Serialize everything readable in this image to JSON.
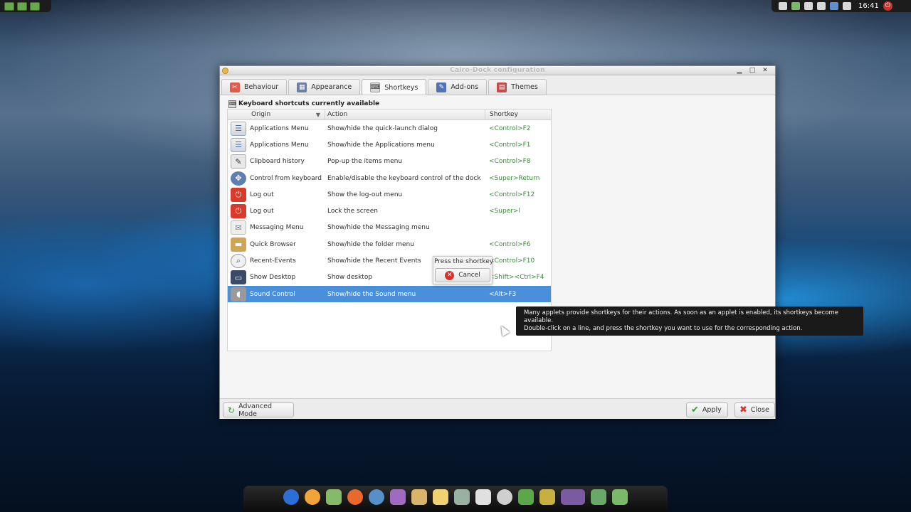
{
  "window": {
    "title": "Cairo-Dock configuration",
    "controls": {
      "minimize": "▁",
      "maximize": "□",
      "close": "✕"
    }
  },
  "tabs": [
    {
      "label": "Behaviour",
      "icon": "behaviour-icon",
      "glyph": "✂"
    },
    {
      "label": "Appearance",
      "icon": "appearance-icon",
      "glyph": "▦"
    },
    {
      "label": "Shortkeys",
      "icon": "shortkeys-icon",
      "glyph": "⌨",
      "active": true
    },
    {
      "label": "Add-ons",
      "icon": "addons-icon",
      "glyph": "✎"
    },
    {
      "label": "Themes",
      "icon": "themes-icon",
      "glyph": "▤"
    }
  ],
  "section": {
    "title": "Keyboard shortcuts currently available"
  },
  "table": {
    "headers": {
      "origin": "Origin",
      "action": "Action",
      "shortkey": "Shortkey"
    },
    "rows": [
      {
        "origin": "Applications Menu",
        "action": "Show/hide the quick-launch dialog",
        "shortkey": "<Control>F2",
        "icon": "applications-menu-icon"
      },
      {
        "origin": "Applications Menu",
        "action": "Show/hide the Applications menu",
        "shortkey": "<Control>F1",
        "icon": "applications-menu-icon"
      },
      {
        "origin": "Clipboard history",
        "action": "Pop-up the items menu",
        "shortkey": "<Control>F8",
        "icon": "clipboard-icon"
      },
      {
        "origin": "Control from keyboard",
        "action": "Enable/disable the keyboard control of the dock",
        "shortkey": "<Super>Return",
        "icon": "keyboard-control-icon"
      },
      {
        "origin": "Log out",
        "action": "Show the log-out menu",
        "shortkey": "<Control>F12",
        "icon": "power-icon"
      },
      {
        "origin": "Log out",
        "action": "Lock the screen",
        "shortkey": "<Super>l",
        "icon": "power-icon"
      },
      {
        "origin": "Messaging Menu",
        "action": "Show/hide the Messaging menu",
        "shortkey": "",
        "icon": "mail-icon"
      },
      {
        "origin": "Quick Browser",
        "action": "Show/hide the folder menu",
        "shortkey": "<Control>F6",
        "icon": "folder-icon"
      },
      {
        "origin": "Recent-Events",
        "action": "Show/hide the Recent Events",
        "shortkey": "<Control>F10",
        "icon": "search-icon"
      },
      {
        "origin": "Show Desktop",
        "action": "Show desktop",
        "shortkey": "<Shift><Ctrl>F4",
        "icon": "desktop-icon"
      },
      {
        "origin": "Sound Control",
        "action": "Show/hide the Sound menu",
        "shortkey": "<Alt>F3",
        "icon": "sound-icon",
        "selected": true
      }
    ]
  },
  "shortkey_popup": {
    "label": "Press the shortkey",
    "cancel": "Cancel"
  },
  "buttons": {
    "advanced_mode": "Advanced Mode",
    "apply": "Apply",
    "close": "Close"
  },
  "tooltip": {
    "line1": "Many applets provide shortkeys for their actions. As soon as an applet is enabled, its shortkeys become available.",
    "line2": "Double-click on a line, and press the shortkey you want to use for the corresponding action."
  },
  "topbar": {
    "clock": "16:41"
  },
  "colors": {
    "selection": "#4a8fd9",
    "shortkey_text": "#3a8a3a",
    "tooltip_bg": "#1a1a1a"
  }
}
